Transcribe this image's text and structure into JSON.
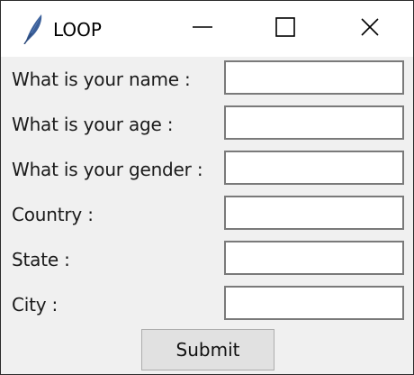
{
  "window": {
    "title": "LOOP",
    "icon": "feather-icon",
    "controls": {
      "minimize_icon": "minimize-icon",
      "maximize_icon": "maximize-icon",
      "close_icon": "close-icon"
    }
  },
  "form": {
    "fields": [
      {
        "label": "What is your name :",
        "value": ""
      },
      {
        "label": "What is your age :",
        "value": ""
      },
      {
        "label": "What is your gender :",
        "value": ""
      },
      {
        "label": "Country :",
        "value": ""
      },
      {
        "label": "State :",
        "value": ""
      },
      {
        "label": "City :",
        "value": ""
      }
    ],
    "submit_label": "Submit"
  },
  "colors": {
    "window_bg": "#f0f0f0",
    "titlebar_bg": "#ffffff",
    "field_border": "#7a7a7a",
    "button_bg": "#e1e1e1"
  }
}
